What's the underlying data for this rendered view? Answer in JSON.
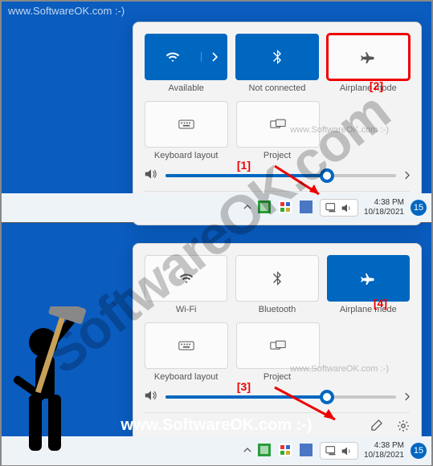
{
  "watermark": "www.SoftwareOK.com :-)",
  "watermark_brand": "SoftwareOK.com",
  "top": {
    "tiles_row1": [
      {
        "label": "Available",
        "icon": "wifi"
      },
      {
        "label": "Not connected",
        "icon": "bluetooth"
      },
      {
        "label": "Airplane mode",
        "icon": "airplane"
      }
    ],
    "tiles_row2": [
      {
        "label": "Keyboard layout",
        "icon": "keyboard"
      },
      {
        "label": "Project",
        "icon": "project"
      }
    ],
    "slider_percent": 70
  },
  "bottom": {
    "tiles_row1": [
      {
        "label": "Wi-Fi",
        "icon": "wifi"
      },
      {
        "label": "Bluetooth",
        "icon": "bluetooth"
      },
      {
        "label": "Airplane mode",
        "icon": "airplane"
      }
    ],
    "tiles_row2": [
      {
        "label": "Keyboard layout",
        "icon": "keyboard"
      },
      {
        "label": "Project",
        "icon": "project"
      }
    ],
    "slider_percent": 70
  },
  "annotations": {
    "a1": "[1]",
    "a2": "[2]",
    "a3": "[3]",
    "a4": "[4]"
  },
  "taskbar": {
    "time": "4:38 PM",
    "date": "10/18/2021",
    "notif_count": "15"
  }
}
